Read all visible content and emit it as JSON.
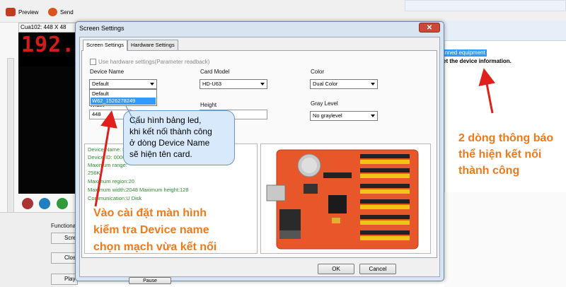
{
  "toolbar": {
    "preview_label": "Preview",
    "send_label": "Send"
  },
  "led_panel": {
    "header": "Cua102: 448 X 48",
    "display_text": "192.1"
  },
  "left_side": {
    "functional_label": "Functional",
    "buttons": [
      "Scree",
      "Clos",
      "Cha",
      "Play"
    ]
  },
  "right_panel": {
    "selected_item": "anned equipment",
    "message": "et the device information.",
    "annotation": [
      "2 dòng thông báo",
      "thể hiện kết nối",
      "thành công"
    ]
  },
  "dialog": {
    "title": "Screen Settings",
    "close_symbol": "✕",
    "tabs": [
      {
        "label": "Screen Settings"
      },
      {
        "label": "Hardware Settings"
      }
    ],
    "use_hw_label": "Use hardware settings(Parameter readback)",
    "device_name": {
      "label": "Device Name",
      "value": "Default",
      "options": [
        "Default",
        "W62_1526278249"
      ]
    },
    "card_model": {
      "label": "Card Model",
      "value": "HD-U63"
    },
    "color": {
      "label": "Color",
      "value": "Dual Color"
    },
    "width": {
      "label": "Width",
      "value": "448"
    },
    "height": {
      "label": "Height"
    },
    "gray_level": {
      "label": "Gray Level",
      "value": "No graylevel"
    },
    "info_lines": [
      "Device Name: De",
      "Device ID: 0000",
      "Maximum range:",
      "256K",
      "Maximum region:20",
      "Maximum width:2048 Maximum height:128",
      "Communication:U Disk"
    ],
    "ok_label": "OK",
    "cancel_label": "Cancel",
    "bottom_buttons": [
      "Pause"
    ]
  },
  "tooltip": {
    "text": [
      "Cấu hình bảng led,",
      "khi kết nối thành công",
      "ở dòng Device Name",
      "sẽ hiện tên card."
    ]
  },
  "annotation_bottom": [
    "Vào cài đặt màn hình",
    "kiểm tra Device name",
    "chọn mạch vừa kết nối"
  ],
  "colors": {
    "annotation": "#f07a1a",
    "arrow": "#e0201c",
    "selection": "#3399ff",
    "board": "#e8572a",
    "led": "#d41a1a"
  }
}
